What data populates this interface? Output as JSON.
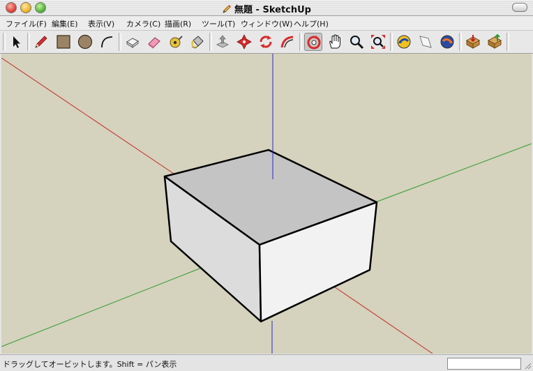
{
  "window": {
    "title": "無題 - SketchUp",
    "title_icon": "pencil-doc-icon"
  },
  "menu": {
    "items": [
      {
        "label": "ファイル(F)"
      },
      {
        "label": "編集(E)"
      },
      {
        "label": "表示(V)"
      },
      {
        "label": "カメラ(C)"
      },
      {
        "label": "描画(R)"
      },
      {
        "label": "ツール(T)"
      },
      {
        "label": "ウィンドウ(W)"
      },
      {
        "label": "ヘルプ(H)"
      }
    ]
  },
  "toolbar": {
    "tools": [
      {
        "name": "select",
        "icon": "arrow-cursor-icon"
      },
      {
        "name": "line",
        "icon": "pencil-icon"
      },
      {
        "name": "rectangle",
        "icon": "rectangle-icon"
      },
      {
        "name": "circle",
        "icon": "circle-icon"
      },
      {
        "name": "arc",
        "icon": "arc-icon"
      },
      {
        "name": "make-component",
        "icon": "component-icon"
      },
      {
        "name": "eraser",
        "icon": "eraser-icon"
      },
      {
        "name": "tape-measure",
        "icon": "tape-measure-icon"
      },
      {
        "name": "paint-bucket",
        "icon": "paint-bucket-icon"
      },
      {
        "name": "push-pull",
        "icon": "push-pull-icon"
      },
      {
        "name": "move",
        "icon": "move-icon"
      },
      {
        "name": "rotate",
        "icon": "rotate-icon"
      },
      {
        "name": "follow-me",
        "icon": "follow-me-icon"
      },
      {
        "name": "orbit",
        "icon": "orbit-icon",
        "active": true
      },
      {
        "name": "pan",
        "icon": "hand-icon"
      },
      {
        "name": "zoom",
        "icon": "magnifier-icon"
      },
      {
        "name": "zoom-extents",
        "icon": "zoom-extents-icon"
      },
      {
        "name": "previous-view",
        "icon": "previous-view-icon"
      },
      {
        "name": "next-view",
        "icon": "next-view-icon"
      },
      {
        "name": "section-plane",
        "icon": "section-icon"
      },
      {
        "name": "get-models",
        "icon": "get-models-icon"
      },
      {
        "name": "share-model",
        "icon": "share-model-icon"
      }
    ]
  },
  "viewport": {
    "background": "#d5d2bd",
    "axis_colors": {
      "red": "#c42a2a",
      "green": "#2a9a2a",
      "blue": "#2a2ac4"
    },
    "face_colors": {
      "top": "#c4c4c4",
      "front": "#f2f2f2",
      "side": "#dcdcdc"
    }
  },
  "status": {
    "text": "ドラッグしてオービットします。Shift = パン表示",
    "measurements_value": ""
  }
}
